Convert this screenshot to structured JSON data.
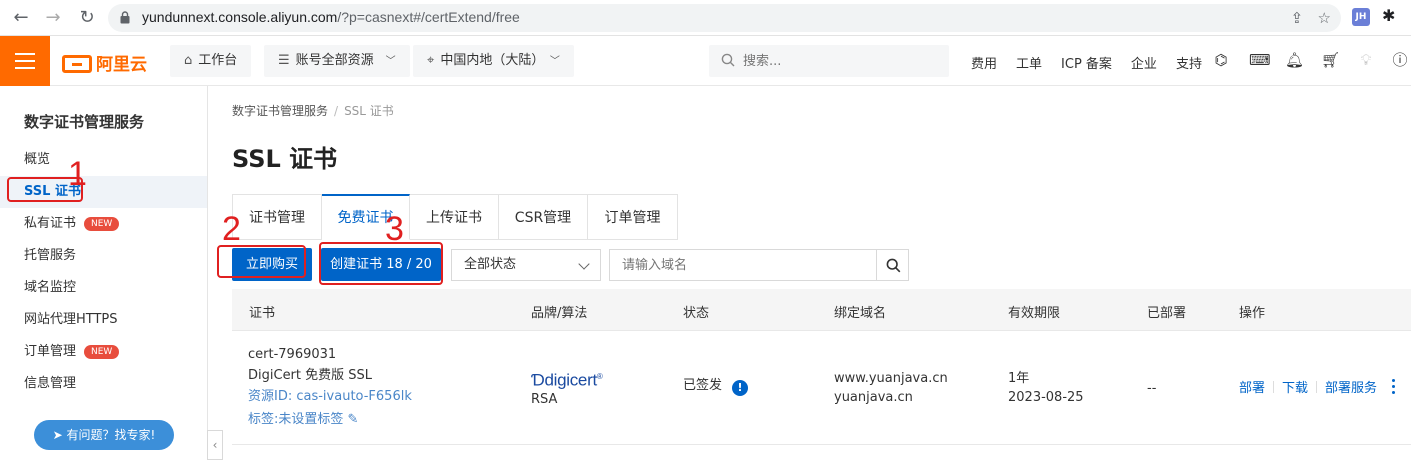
{
  "browser": {
    "url_host": "yundunnext.console.aliyun.com",
    "url_rest": "/?p=casnext#/certExtend/free",
    "ext_badge": "JH"
  },
  "topbar": {
    "logo_text": "阿里云",
    "workbench": "工作台",
    "account_resources": "账号全部资源",
    "region": "中国内地（大陆）",
    "search_placeholder": "搜索...",
    "links": [
      "费用",
      "工单",
      "ICP 备案",
      "企业",
      "支持"
    ]
  },
  "sidebar": {
    "title": "数字证书管理服务",
    "items": [
      {
        "label": "概览",
        "badge": ""
      },
      {
        "label": "SSL 证书",
        "badge": ""
      },
      {
        "label": "私有证书",
        "badge": "NEW"
      },
      {
        "label": "托管服务",
        "badge": ""
      },
      {
        "label": "域名监控",
        "badge": ""
      },
      {
        "label": "网站代理HTTPS",
        "badge": ""
      },
      {
        "label": "订单管理",
        "badge": "NEW"
      },
      {
        "label": "信息管理",
        "badge": ""
      }
    ],
    "help_button": "有问题？找专家!"
  },
  "breadcrumb": {
    "root": "数字证书管理服务",
    "current": "SSL 证书"
  },
  "page_title": "SSL 证书",
  "tabs": [
    "证书管理",
    "免费证书",
    "上传证书",
    "CSR管理",
    "订单管理"
  ],
  "toolbar": {
    "buy_button": "立即购买",
    "create_button": "创建证书 18 / 20",
    "status_select": "全部状态",
    "domain_placeholder": "请输入域名"
  },
  "table": {
    "headers": [
      "证书",
      "品牌/算法",
      "状态",
      "绑定域名",
      "有效期限",
      "已部署",
      "操作"
    ],
    "rows": [
      {
        "cert_name": "cert-7969031",
        "cert_type": "DigiCert 免费版 SSL",
        "resource_id": "资源ID: cas-ivauto-F656lk",
        "tag": "标签:未设置标签",
        "brand": "digicert",
        "algorithm": "RSA",
        "status": "已签发",
        "domains": [
          "www.yuanjava.cn",
          "yuanjava.cn"
        ],
        "validity": "1年",
        "expiry": "2023-08-25",
        "deployed": "--",
        "actions": [
          "部署",
          "下载",
          "部署服务"
        ]
      }
    ]
  },
  "annotations": [
    "1",
    "2",
    "3"
  ],
  "colors": {
    "accent": "#0064c8",
    "brand_orange": "#ff6a00",
    "annotation_red": "#e02020",
    "badge_red": "#e84d3d"
  }
}
